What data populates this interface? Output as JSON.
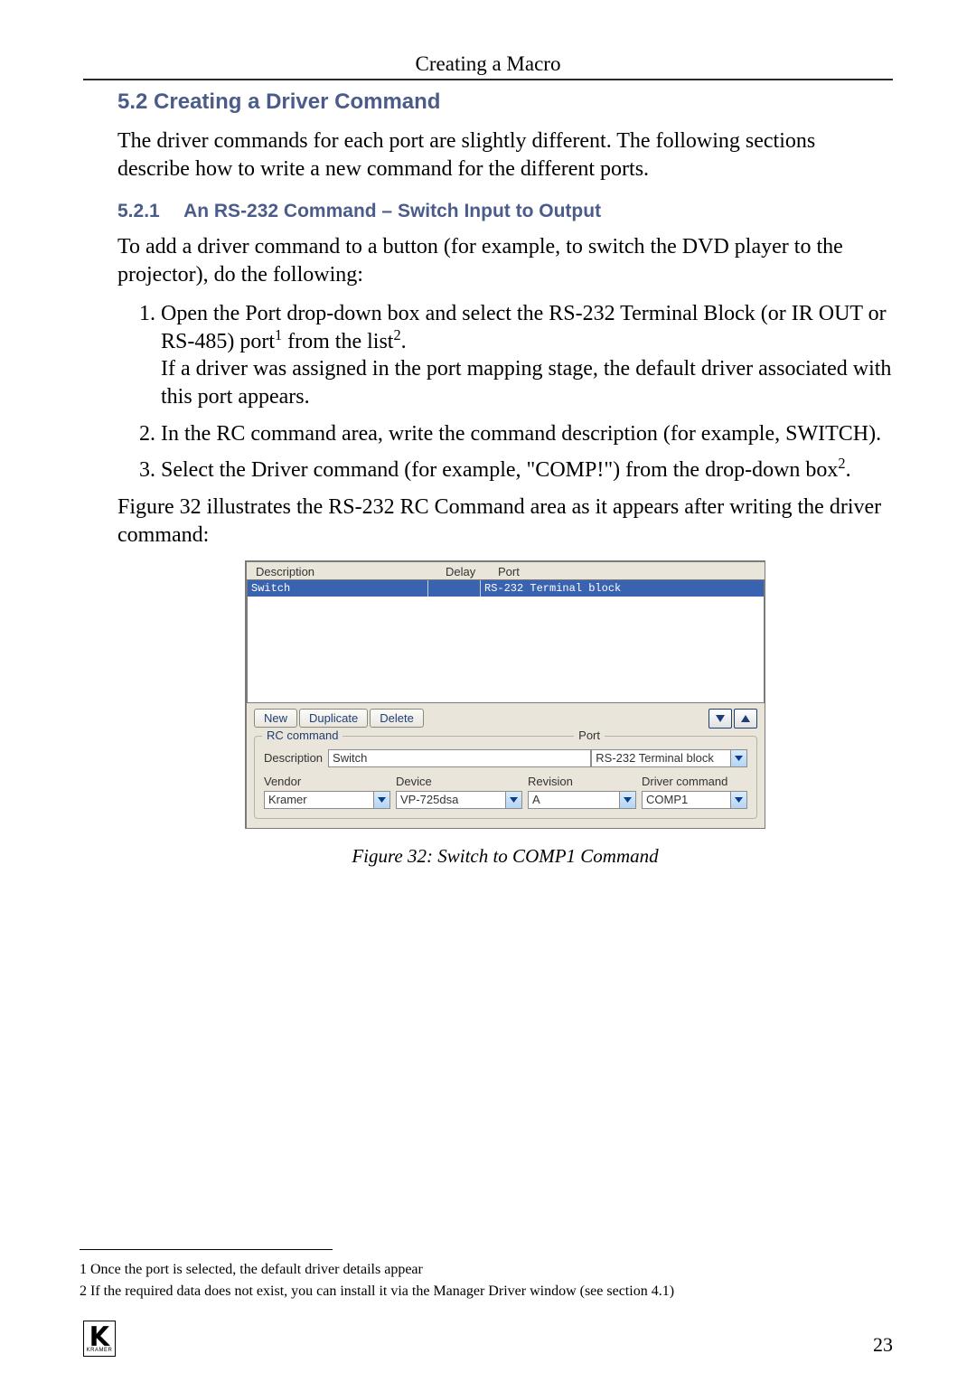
{
  "running_head": "Creating a Macro",
  "section": {
    "number": "5.2",
    "title": "Creating a Driver Command",
    "intro": "The driver commands for each port are slightly different. The following sections describe how to write a new command for the different ports."
  },
  "subsection": {
    "number": "5.2.1",
    "title": "An RS-232 Command – Switch Input to Output",
    "lead_in": "To add a driver command to a button (for example, to switch the DVD player to the projector), do the following:",
    "steps": [
      {
        "main_a": "Open the Port drop-down box and select the RS-232 Terminal Block (or IR OUT or RS-485) port",
        "sup_a": "1",
        "main_b": " from the list",
        "sup_b": "2",
        "main_c": ".",
        "cont": "If a driver was assigned in the port mapping stage, the default driver associated with this port appears."
      },
      {
        "main_a": "In the RC command area, write the command description (for example, SWITCH)."
      },
      {
        "main_a": "Select the Driver command (for example, \"COMP!\") from the drop-down box",
        "sup_a": "2",
        "main_b": "."
      }
    ],
    "after_steps": "Figure 32 illustrates the RS-232 RC Command area as it appears after writing the driver command:"
  },
  "figure": {
    "top_labels": {
      "description": "Description",
      "delay": "Delay",
      "port": "Port"
    },
    "row": {
      "description": "Switch",
      "delay": "",
      "port": "RS-232 Terminal block"
    },
    "buttons": {
      "new": "New",
      "duplicate": "Duplicate",
      "delete": "Delete"
    },
    "group_title": "RC command",
    "port_label": "Port",
    "description_label": "Description",
    "description_value": "Switch",
    "port_value": "RS-232 Terminal block",
    "cols": {
      "vendor_label": "Vendor",
      "vendor_value": "Kramer",
      "device_label": "Device",
      "device_value": "VP-725dsa",
      "revision_label": "Revision",
      "revision_value": "A",
      "driver_label": "Driver command",
      "driver_value": "COMP1"
    },
    "caption": "Figure 32: Switch to COMP1 Command"
  },
  "footnotes": [
    "1 Once the port is selected, the default driver details appear",
    "2 If the required data does not exist, you can install it via the Manager Driver window (see section 4.1)"
  ],
  "page_number": "23",
  "logo_text": "KRAMER"
}
